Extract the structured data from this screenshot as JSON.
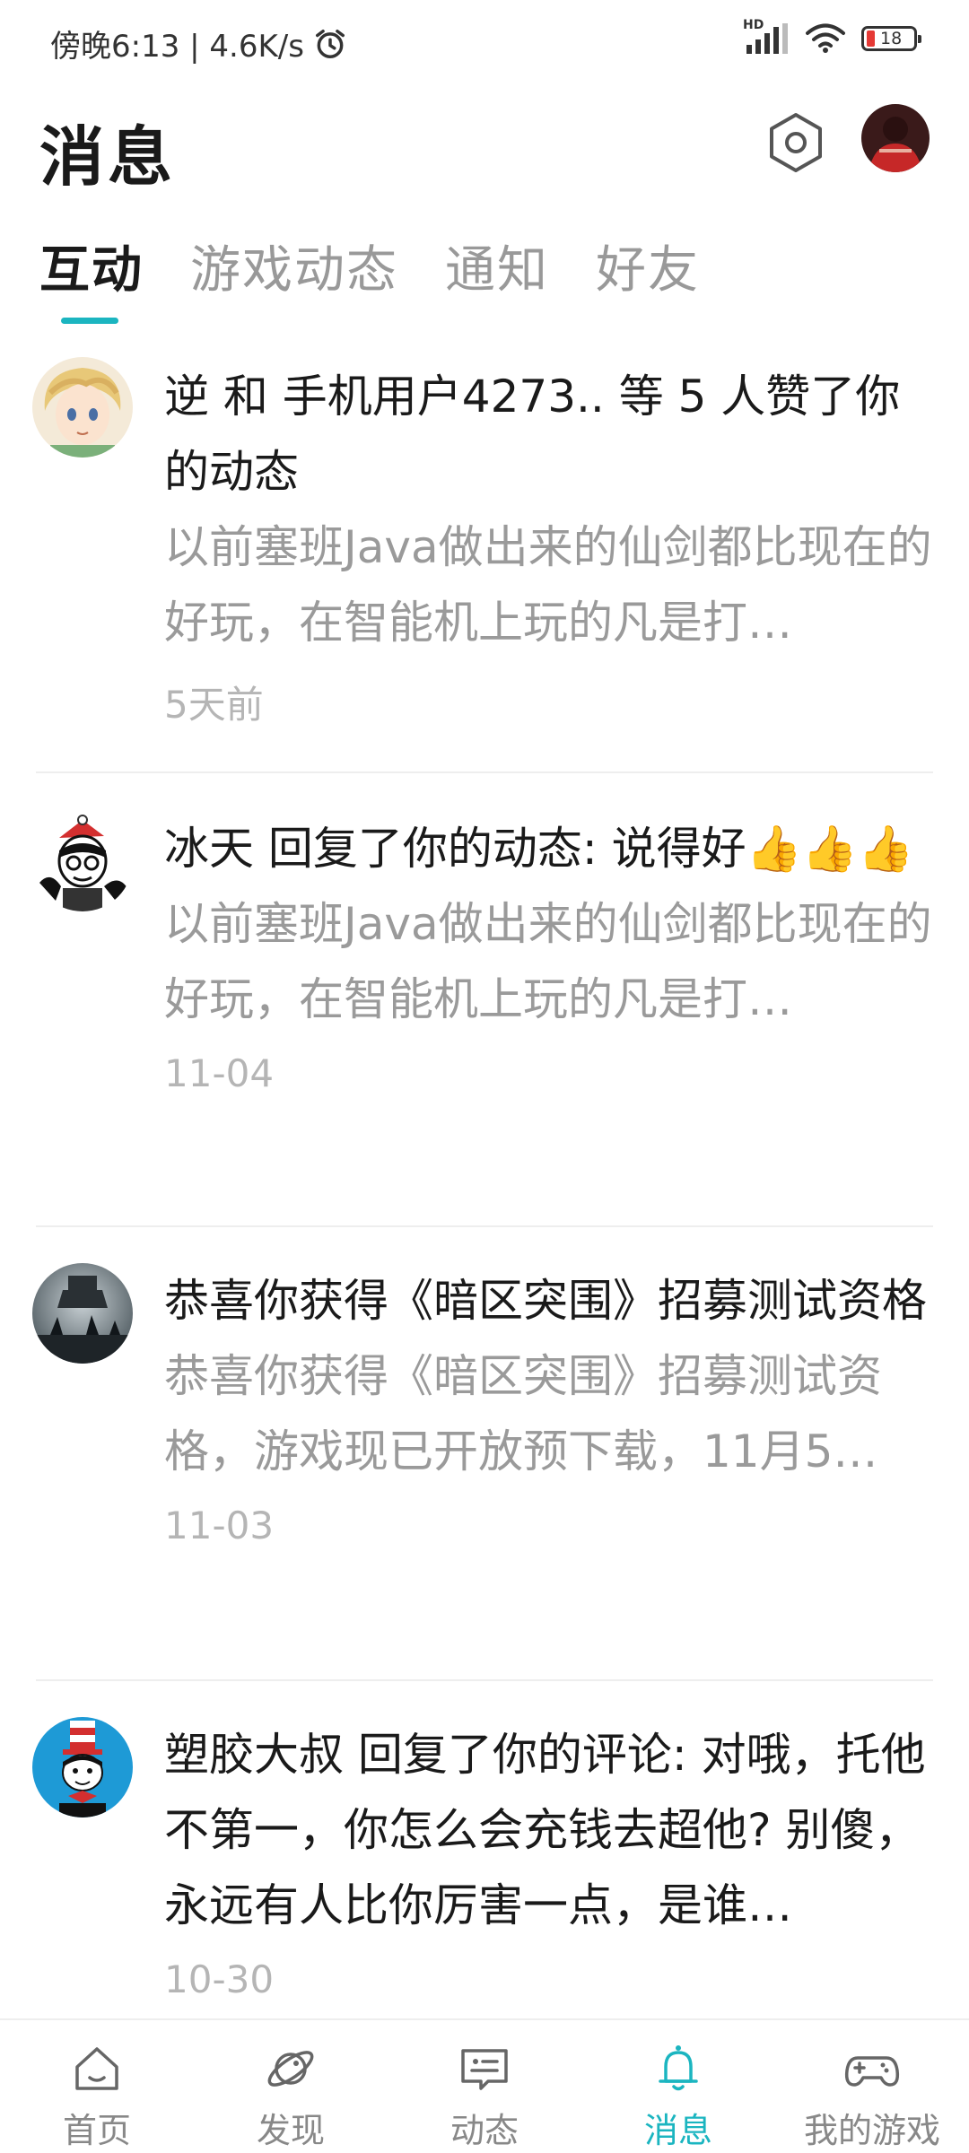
{
  "colors": {
    "accent": "#1bb5c0",
    "title_text": "#1a1a1a",
    "secondary_text": "#9a9a9a",
    "time_text": "#b5b5b5",
    "battery_low": "#e53935"
  },
  "status_bar": {
    "left_text": "傍晚6:13 | 4.6K/s",
    "alarm_icon": "alarm-clock-icon",
    "network_badge": "HD",
    "battery_level": "18"
  },
  "header": {
    "title": "消息",
    "settings_icon": "hexagon-settings-icon"
  },
  "tabs": [
    {
      "label": "互动",
      "active": true
    },
    {
      "label": "游戏动态",
      "active": false
    },
    {
      "label": "通知",
      "active": false
    },
    {
      "label": "好友",
      "active": false
    }
  ],
  "messages": [
    {
      "title": "逆 和 手机用户4273.. 等 5 人赞了你的动态",
      "preview": "以前塞班Java做出来的仙剑都比现在的好玩，在智能机上玩的凡是打…",
      "time": "5天前"
    },
    {
      "title": "冰天 回复了你的动态: 说得好👍👍👍",
      "preview": "以前塞班Java做出来的仙剑都比现在的好玩，在智能机上玩的凡是打…",
      "time": "11-04"
    },
    {
      "title": "恭喜你获得《暗区突围》招募测试资格",
      "preview": "恭喜你获得《暗区突围》招募测试资格，游戏现已开放预下载，11月5…",
      "time": "11-03"
    },
    {
      "title": "塑胶大叔 回复了你的评论: 对哦，托他不第一，你怎么会充钱去超他? 别傻，永远有人比你厉害一点，是谁…",
      "preview": "",
      "time": "10-30"
    }
  ],
  "bottom_nav": [
    {
      "label": "首页",
      "icon": "home-icon",
      "active": false
    },
    {
      "label": "发现",
      "icon": "planet-icon",
      "active": false
    },
    {
      "label": "动态",
      "icon": "chat-card-icon",
      "active": false
    },
    {
      "label": "消息",
      "icon": "bell-icon",
      "active": true
    },
    {
      "label": "我的游戏",
      "icon": "gamepad-icon",
      "active": false
    }
  ]
}
